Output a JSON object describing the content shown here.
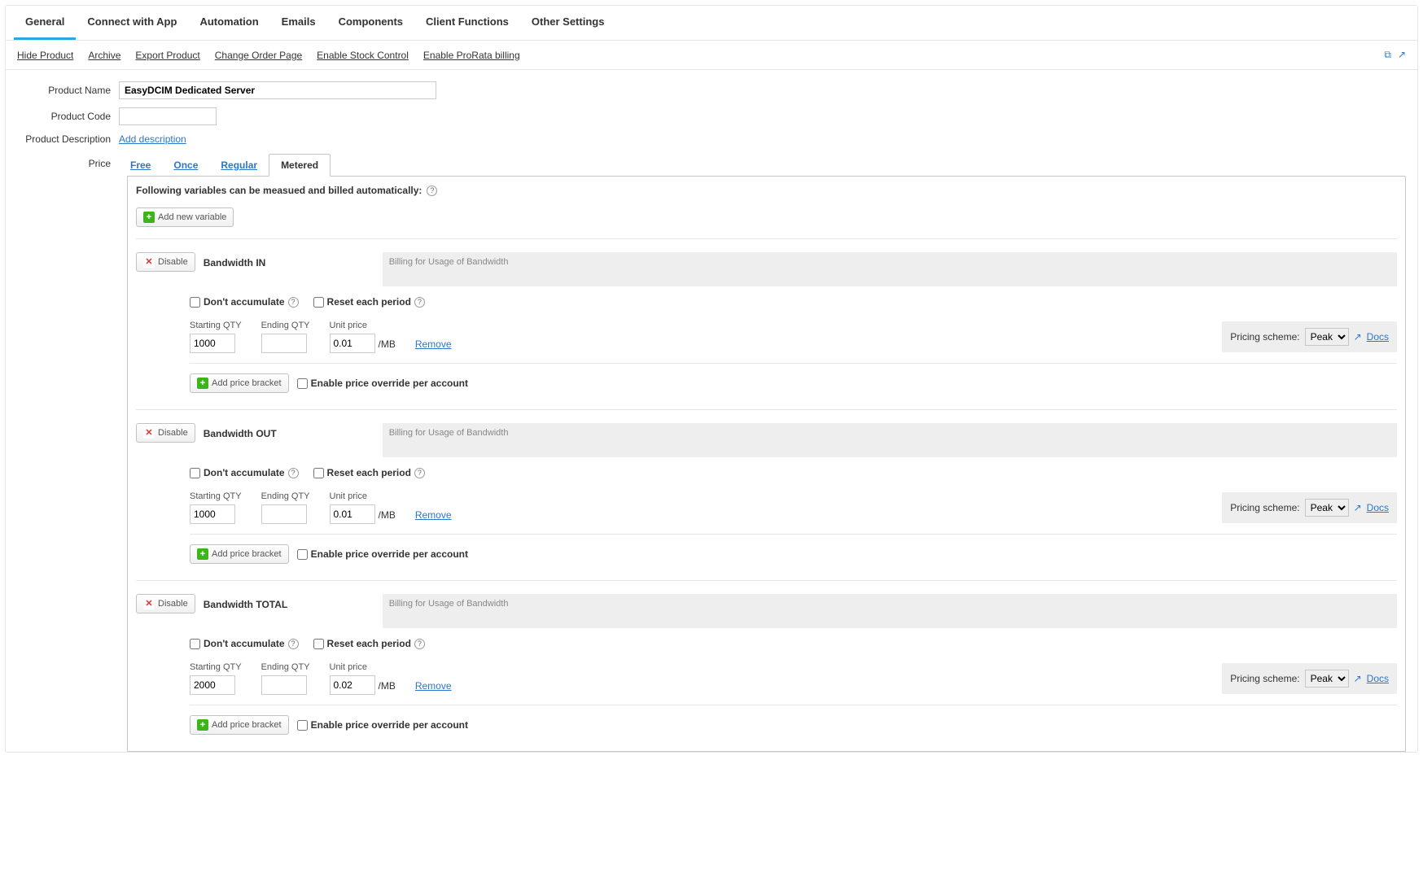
{
  "mainTabs": [
    "General",
    "Connect with App",
    "Automation",
    "Emails",
    "Components",
    "Client Functions",
    "Other Settings"
  ],
  "activeMainTab": 0,
  "actions": [
    "Hide Product",
    "Archive",
    "Export Product",
    "Change Order Page",
    "Enable Stock Control",
    "Enable ProRata billing"
  ],
  "form": {
    "productNameLabel": "Product Name",
    "productNameValue": "EasyDCIM Dedicated Server",
    "productCodeLabel": "Product Code",
    "productCodeValue": "",
    "productDescLabel": "Product Description",
    "addDescription": "Add description",
    "priceLabel": "Price",
    "priceTabs": [
      "Free",
      "Once",
      "Regular",
      "Metered"
    ],
    "activePriceTab": 3
  },
  "metered": {
    "info": "Following variables can be measued and billed automatically:",
    "addNewVariable": "Add new variable",
    "dontAccumulate": "Don't accumulate",
    "resetEachPeriod": "Reset each period",
    "startingQty": "Starting QTY",
    "endingQty": "Ending QTY",
    "unitPrice": "Unit price",
    "pricingScheme": "Pricing scheme:",
    "schemeOption": "Peak",
    "docs": "Docs",
    "remove": "Remove",
    "disable": "Disable",
    "addBracket": "Add price bracket",
    "enableOverride": "Enable price override per account",
    "billingDesc": "Billing for Usage of Bandwidth"
  },
  "variables": [
    {
      "title": "Bandwidth IN",
      "startQty": "1000",
      "endQty": "",
      "unitPrice": "0.01",
      "unit": "/MB"
    },
    {
      "title": "Bandwidth OUT",
      "startQty": "1000",
      "endQty": "",
      "unitPrice": "0.01",
      "unit": "/MB"
    },
    {
      "title": "Bandwidth TOTAL",
      "startQty": "2000",
      "endQty": "",
      "unitPrice": "0.02",
      "unit": "/MB"
    }
  ]
}
